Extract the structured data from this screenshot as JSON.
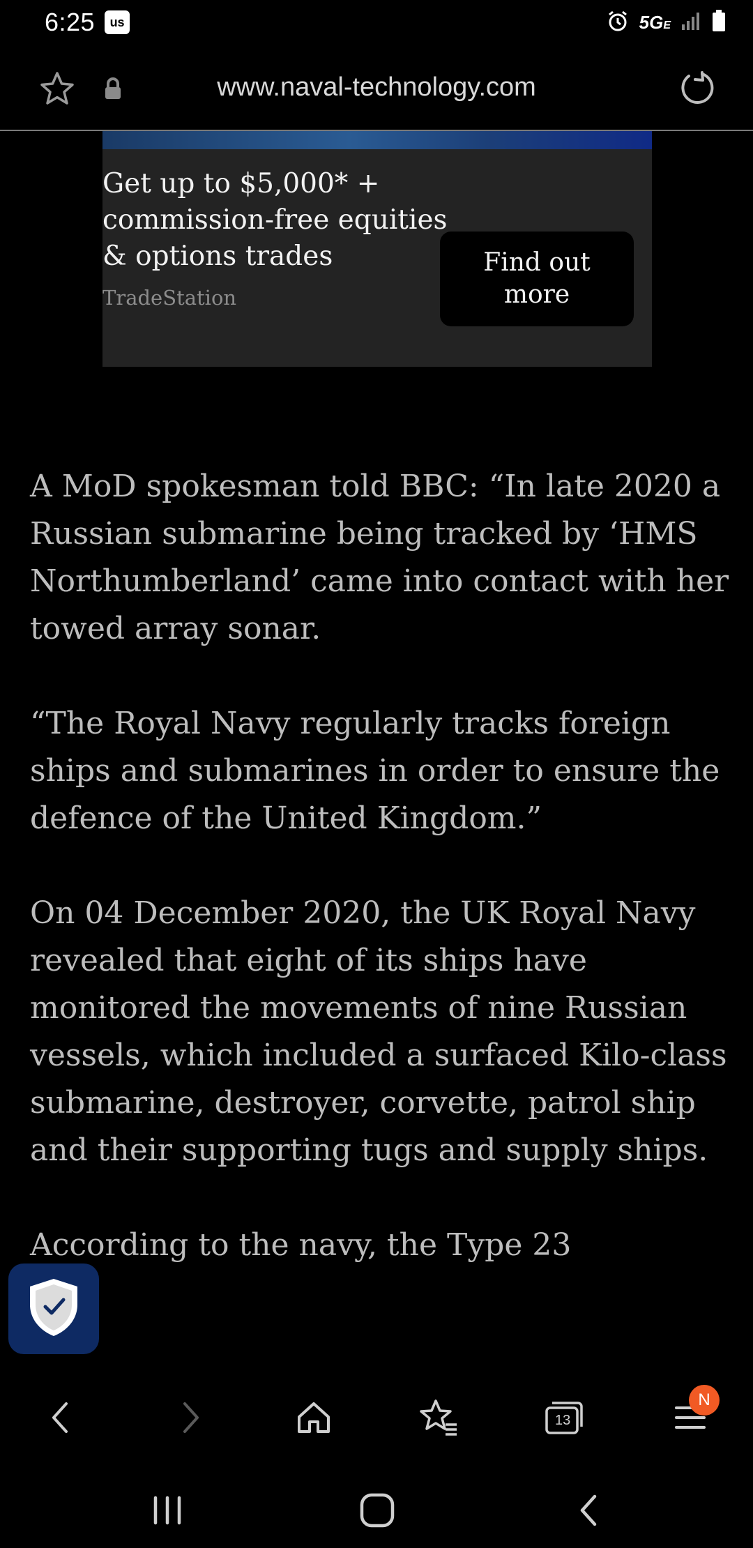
{
  "status_bar": {
    "time": "6:25",
    "carrier_badge": "us",
    "network": "5G",
    "network_sub": "E",
    "icons": [
      "alarm-icon",
      "signal-icon",
      "battery-icon"
    ]
  },
  "browser": {
    "url": "www.naval-technology.com",
    "icons_left": [
      "star-icon",
      "lock-icon"
    ],
    "reload_icon": "reload-icon"
  },
  "ad": {
    "headline": "Get up to $5,000* + commission-free equities & options trades",
    "brand": "TradeStation",
    "cta": "Find out more"
  },
  "article": {
    "paragraphs": [
      "A MoD spokesman told BBC: “In late 2020 a Russian submarine being tracked by ‘HMS Northumberland’ came into contact with her towed array sonar.",
      "“The Royal Navy regularly tracks foreign ships and submarines in order to ensure the defence of the United Kingdom.”",
      "On 04 December 2020, the UK Royal Navy revealed that eight of its ships have monitored the movements of nine Russian vessels, which included a surfaced Kilo-class submarine, destroyer, corvette, patrol ship and their supporting tugs and supply ships.",
      "According to the navy, the Type 23"
    ]
  },
  "toolbar": {
    "tabs_count": "13",
    "menu_badge": "N",
    "badge_color": "#f15a24"
  },
  "colors": {
    "background": "#000000",
    "ad_background": "#232323",
    "shield_button": "#0e2a63"
  }
}
